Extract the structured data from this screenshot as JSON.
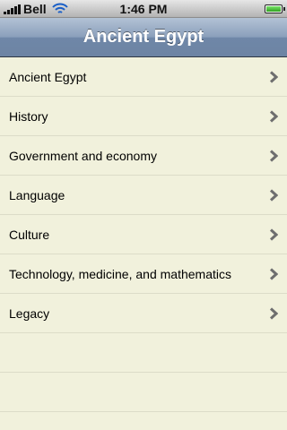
{
  "status_bar": {
    "carrier": "Bell",
    "time": "1:46 PM",
    "battery_level": 1.0,
    "signal_bars": 5,
    "wifi_icon": "wifi-icon",
    "battery_icon": "battery-icon"
  },
  "nav": {
    "title": "Ancient Egypt"
  },
  "colors": {
    "list_background": "#f1f1dc",
    "separator": "#dcdcc8",
    "nav_bar": "#6f87a8",
    "chevron": "#6e6e6e"
  },
  "list": {
    "items": [
      {
        "label": "Ancient Egypt",
        "icon": "chevron-right-icon"
      },
      {
        "label": "History",
        "icon": "chevron-right-icon"
      },
      {
        "label": "Government and economy",
        "icon": "chevron-right-icon"
      },
      {
        "label": "Language",
        "icon": "chevron-right-icon"
      },
      {
        "label": "Culture",
        "icon": "chevron-right-icon"
      },
      {
        "label": "Technology, medicine, and mathematics",
        "icon": "chevron-right-icon"
      },
      {
        "label": "Legacy",
        "icon": "chevron-right-icon"
      }
    ]
  }
}
